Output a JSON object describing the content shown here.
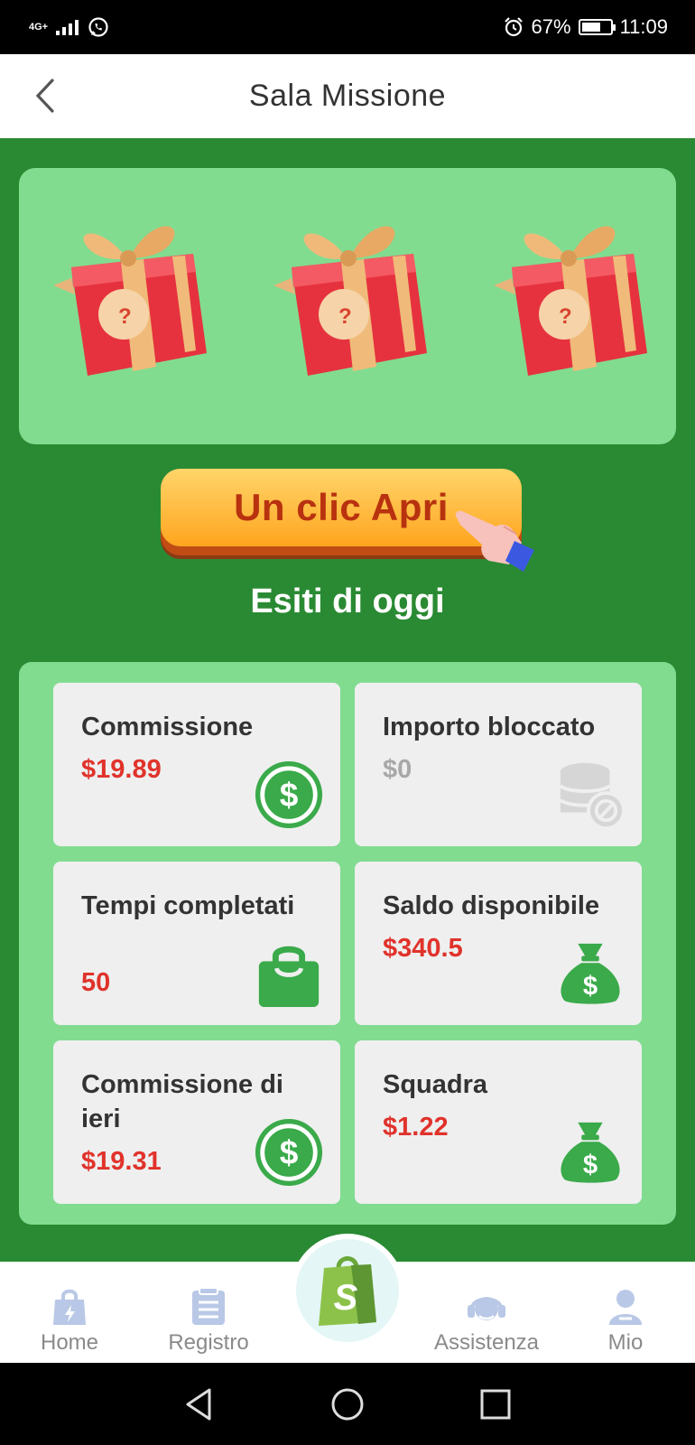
{
  "status_bar": {
    "network": "4G+",
    "battery_percent": "67%",
    "time": "11:09",
    "icons": [
      "signal-icon",
      "whatsapp-icon",
      "alarm-icon",
      "battery-icon"
    ]
  },
  "header": {
    "title": "Sala Missione",
    "back_icon": "chevron-left-icon"
  },
  "gifts": [
    {
      "icon": "gift-box-icon",
      "mark": "?"
    },
    {
      "icon": "gift-box-icon",
      "mark": "?"
    },
    {
      "icon": "gift-box-icon",
      "mark": "?"
    }
  ],
  "open_button": {
    "label": "Un clic Apri",
    "icon": "pointing-hand-icon"
  },
  "results": {
    "title": "Esiti di oggi",
    "cards": [
      {
        "label": "Commissione",
        "value": "$19.89",
        "icon": "dollar-coin-icon"
      },
      {
        "label": "Importo bloccato",
        "value": "$0",
        "icon": "frozen-coins-icon"
      },
      {
        "label": "Tempi completati",
        "value": "50",
        "icon": "shopping-bag-icon"
      },
      {
        "label": "Saldo disponibile",
        "value": "$340.5",
        "icon": "money-bag-icon"
      },
      {
        "label": "Commissione di ieri",
        "value": "$19.31",
        "icon": "dollar-coin-icon"
      },
      {
        "label": "Squadra",
        "value": "$1.22",
        "icon": "money-bag-icon"
      }
    ]
  },
  "bottom_nav": {
    "items": [
      {
        "label": "Home",
        "icon": "home-bag-icon"
      },
      {
        "label": "Registro",
        "icon": "clipboard-icon"
      },
      {
        "label": "Assistenza",
        "icon": "headset-icon"
      },
      {
        "label": "Mio",
        "icon": "user-icon"
      }
    ],
    "center_icon": "shop-bag-s-icon",
    "center_mark": "S"
  },
  "system_nav": {
    "icons": [
      "back-triangle-icon",
      "home-circle-icon",
      "recents-square-icon"
    ]
  },
  "colors": {
    "main_green": "#2a8a33",
    "panel_green": "#82dc90",
    "value_red": "#e0332b",
    "button_orange": "#ffa51f",
    "button_text": "#b8320f"
  }
}
